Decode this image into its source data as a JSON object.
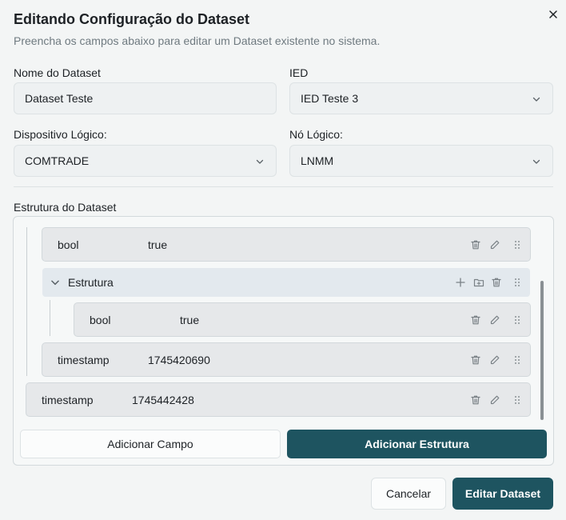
{
  "dialog": {
    "title": "Editando Configuração do Dataset",
    "subtitle": "Preencha os campos abaixo para editar um Dataset existente no sistema."
  },
  "form": {
    "dataset_name_label": "Nome do Dataset",
    "dataset_name_value": "Dataset Teste",
    "ied_label": "IED",
    "ied_value": "IED Teste 3",
    "logical_device_label": "Dispositivo Lógico:",
    "logical_device_value": "COMTRADE",
    "logical_node_label": "Nó Lógico:",
    "logical_node_value": "LNMM"
  },
  "structure": {
    "label": "Estrutura do Dataset",
    "rows": [
      {
        "key": "bool",
        "value": "true"
      },
      {
        "key": "Estrutura",
        "value": ""
      },
      {
        "key": "bool",
        "value": "true"
      },
      {
        "key": "timestamp",
        "value": "1745420690"
      },
      {
        "key": "timestamp",
        "value": "1745442428"
      }
    ],
    "add_field_button": "Adicionar Campo",
    "add_structure_button": "Adicionar Estrutura"
  },
  "footer": {
    "cancel_button": "Cancelar",
    "submit_button": "Editar Dataset"
  },
  "colors": {
    "primary": "#1e5460",
    "background": "#f3f5f5",
    "row_bg": "#e6e8ea",
    "struct_bg": "#e3e9ee"
  },
  "icons": [
    "close-icon",
    "chevron-down-icon",
    "trash-icon",
    "pencil-icon",
    "drag-handle-icon",
    "plus-icon",
    "folder-plus-icon",
    "chevron-expand-icon"
  ]
}
